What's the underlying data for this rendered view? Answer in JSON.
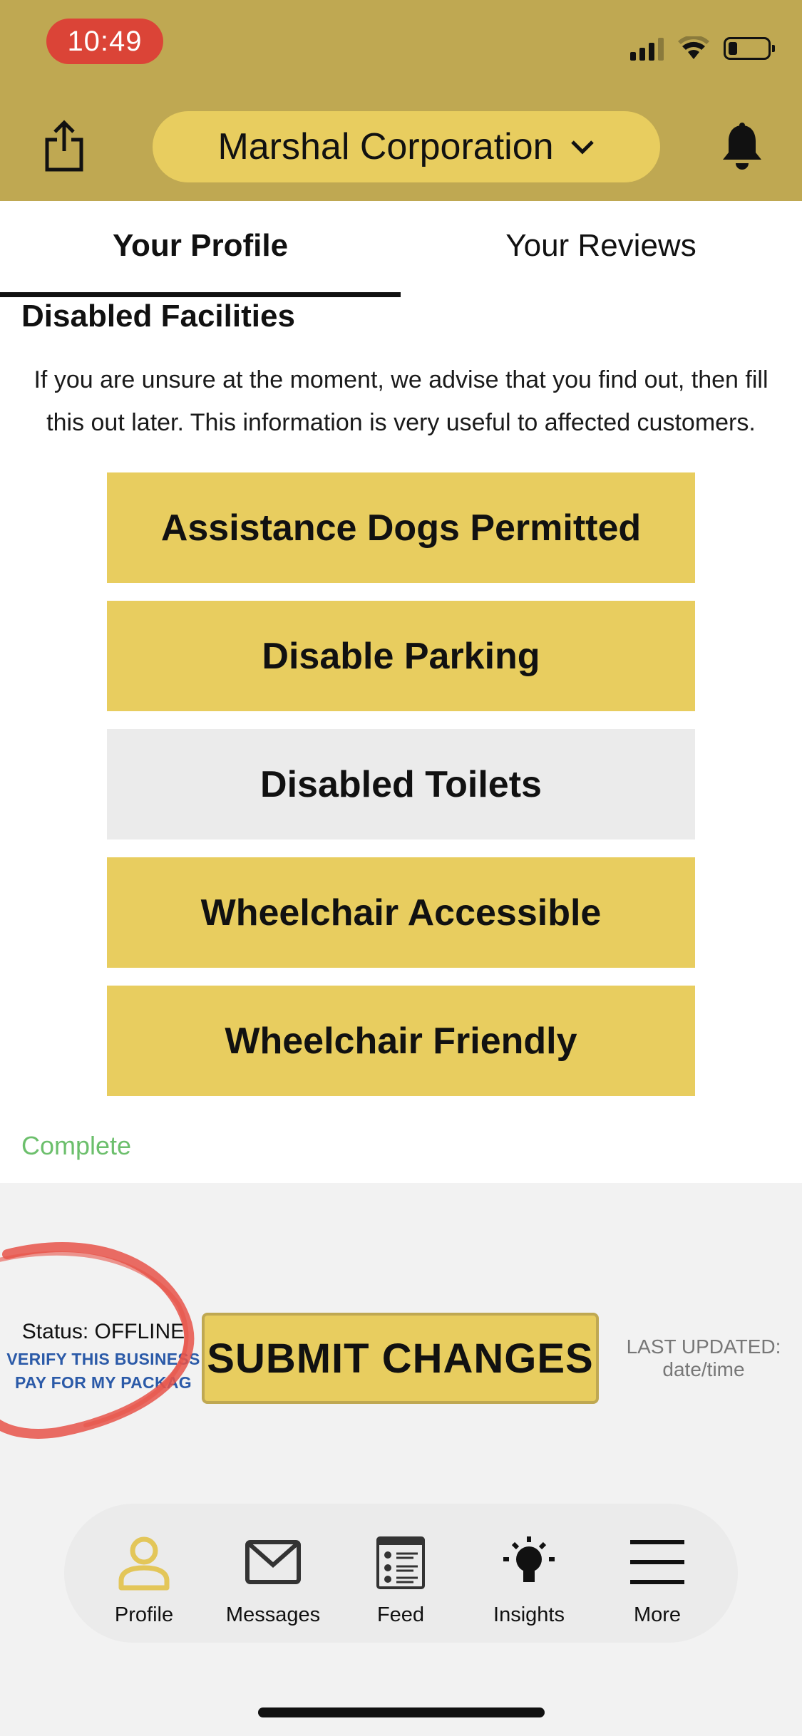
{
  "status_bar": {
    "time": "10:49",
    "battery_level": 0.2
  },
  "header": {
    "company_name": "Marshal Corporation",
    "share_icon": "share-icon",
    "bell_icon": "bell-icon",
    "dropdown_icon": "chevron-down-icon",
    "colors": {
      "header_bg": "#bfa852",
      "pill_bg": "#e8cd5f",
      "time_pill": "#db4437"
    }
  },
  "tabs": [
    {
      "label": "Your Profile",
      "active": true
    },
    {
      "label": "Your Reviews",
      "active": false
    }
  ],
  "section": {
    "title": "Disabled Facilities",
    "description": "If you are unsure at the moment, we advise that you find out, then fill this out later. This information is very useful to affected customers.",
    "facilities": [
      {
        "label": "Assistance Dogs Permitted",
        "selected": true
      },
      {
        "label": "Disable Parking",
        "selected": true
      },
      {
        "label": "Disabled Toilets",
        "selected": false
      },
      {
        "label": "Wheelchair Accessible",
        "selected": true
      },
      {
        "label": "Wheelchair Friendly",
        "selected": true
      }
    ],
    "complete_label": "Complete",
    "colors": {
      "selected": "#e8cd5f",
      "unselected": "#ebebeb",
      "complete": "#6cbf6c"
    }
  },
  "footer": {
    "status": "Status: OFFLINE",
    "verify_link": "VERIFY THIS BUSINESS",
    "pay_link": "PAY FOR MY PACKAG",
    "submit_label": "SUBMIT CHANGES",
    "last_updated_label": "LAST UPDATED:",
    "last_updated_value": "date/time"
  },
  "bottom_nav": [
    {
      "label": "Profile",
      "icon": "profile-icon",
      "active": true
    },
    {
      "label": "Messages",
      "icon": "envelope-icon",
      "active": false
    },
    {
      "label": "Feed",
      "icon": "feed-icon",
      "active": false
    },
    {
      "label": "Insights",
      "icon": "lightbulb-icon",
      "active": false
    },
    {
      "label": "More",
      "icon": "menu-icon",
      "active": false
    }
  ]
}
